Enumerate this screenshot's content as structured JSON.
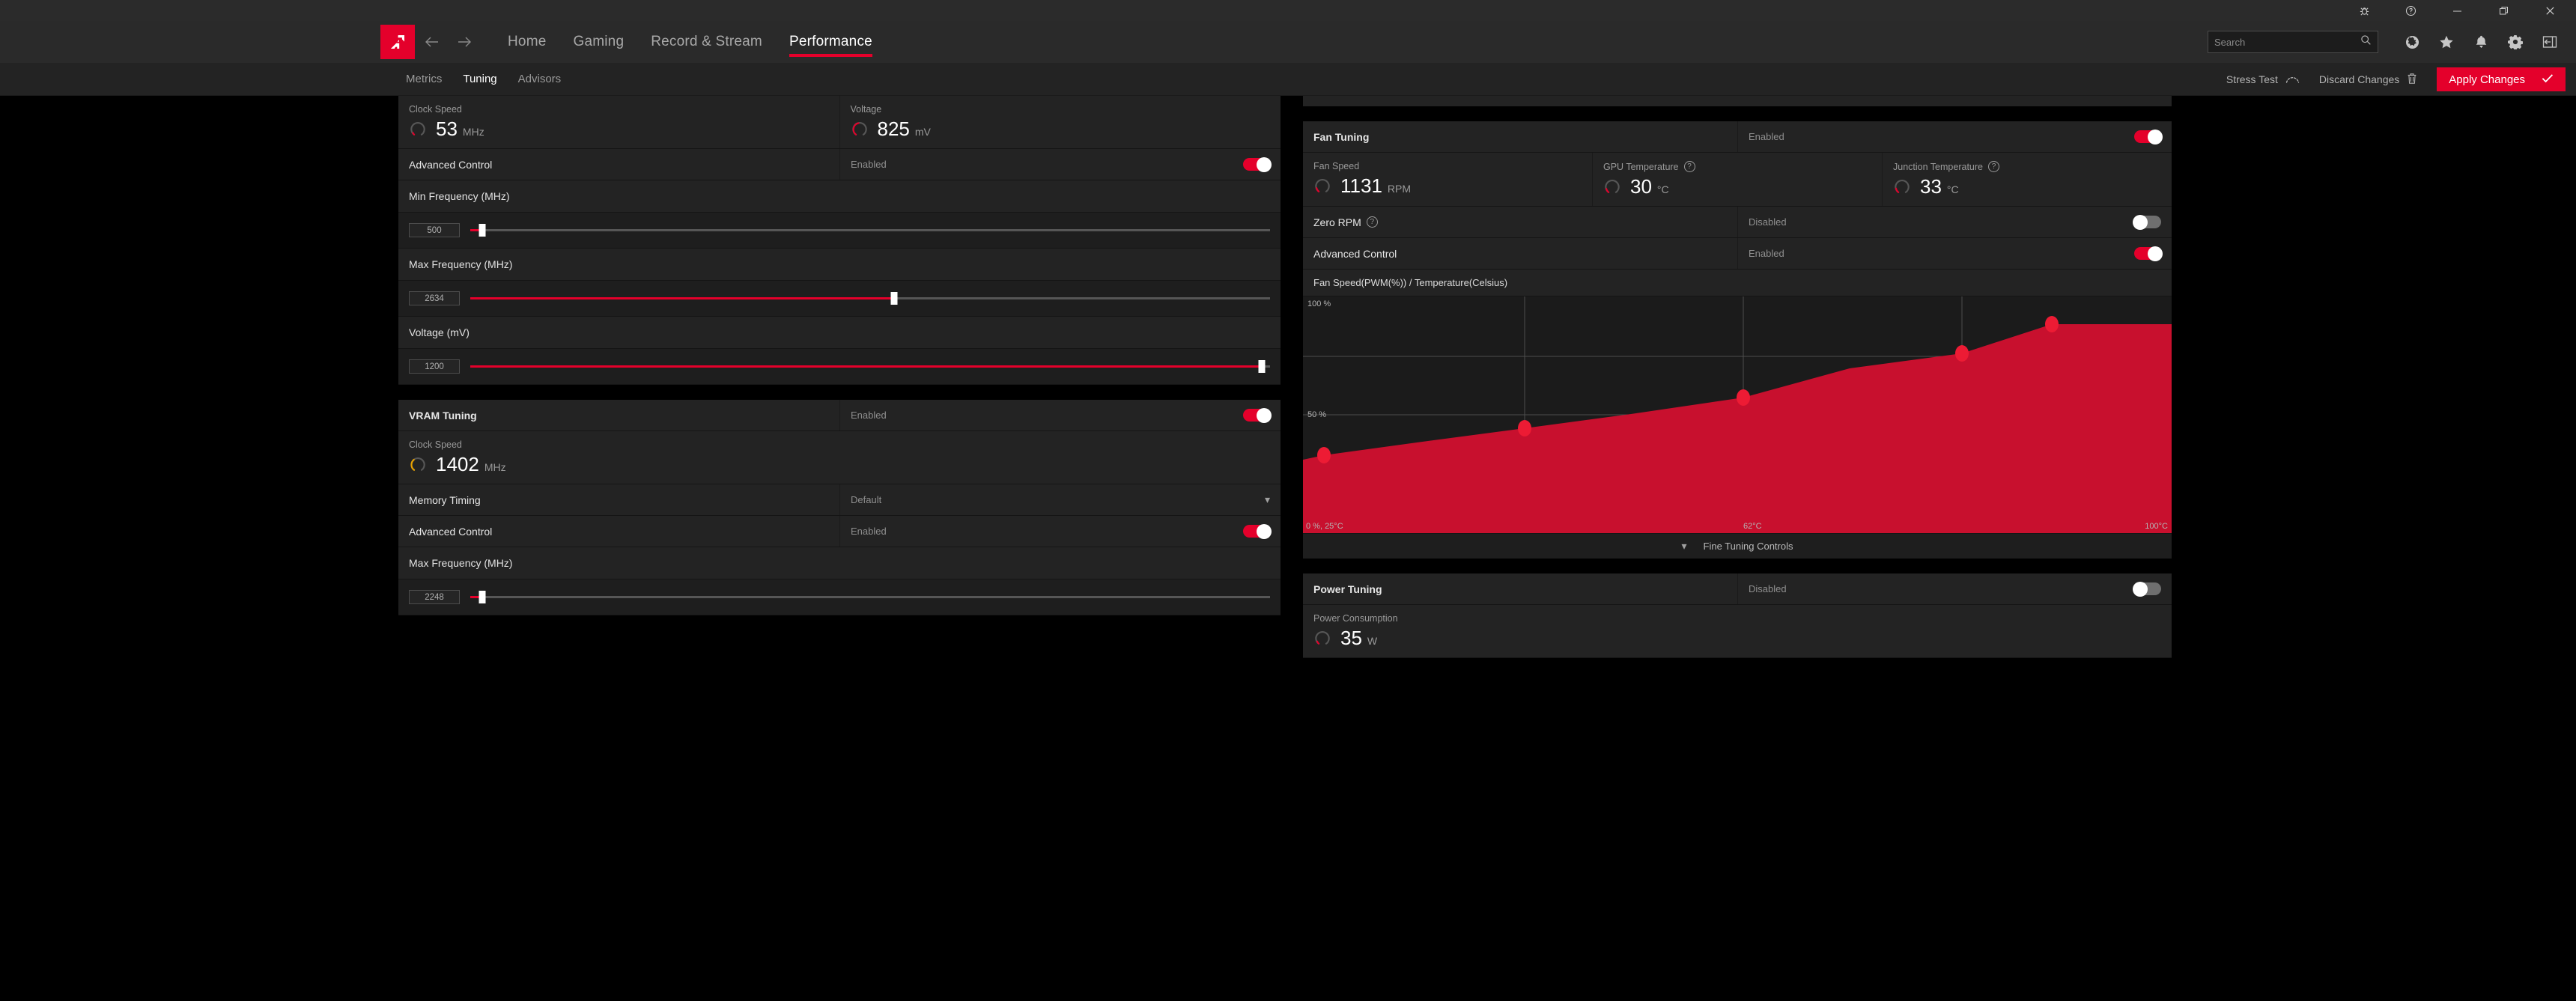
{
  "window": {
    "controls": [
      {
        "name": "bug-report",
        "glyph": "bug"
      },
      {
        "name": "help",
        "glyph": "question"
      },
      {
        "name": "minimize",
        "glyph": "minimize"
      },
      {
        "name": "restore",
        "glyph": "restore"
      },
      {
        "name": "close",
        "glyph": "close"
      }
    ]
  },
  "nav": {
    "brand": "AMD",
    "back": "back-arrow",
    "forward": "forward-arrow",
    "links": [
      {
        "label": "Home",
        "active": false
      },
      {
        "label": "Gaming",
        "active": false
      },
      {
        "label": "Record & Stream",
        "active": false
      },
      {
        "label": "Performance",
        "active": true
      }
    ],
    "search": {
      "value": "",
      "placeholder": "Search"
    },
    "icons": [
      "globe-icon",
      "star-icon",
      "bell-icon",
      "gear-icon",
      "collapse-panel-icon"
    ]
  },
  "subnav": {
    "tabs": [
      {
        "label": "Metrics",
        "active": false
      },
      {
        "label": "Tuning",
        "active": true
      },
      {
        "label": "Advisors",
        "active": false
      }
    ],
    "stress_test": "Stress Test",
    "discard": "Discard Changes",
    "apply": "Apply Changes"
  },
  "gpu_tuning": {
    "metrics": [
      {
        "label": "Clock Speed",
        "value": "53",
        "unit": "MHz",
        "gauge_pct": 4,
        "gauge_color": "#e4002b"
      },
      {
        "label": "Voltage",
        "value": "825",
        "unit": "mV",
        "gauge_pct": 45,
        "gauge_color": "#e4002b"
      }
    ],
    "advanced_control": {
      "label": "Advanced Control",
      "state": "Enabled",
      "on": true
    },
    "sliders": [
      {
        "label": "Min Frequency (MHz)",
        "value": "500",
        "pct": 1.5
      },
      {
        "label": "Max Frequency (MHz)",
        "value": "2634",
        "pct": 53
      },
      {
        "label": "Voltage (mV)",
        "value": "1200",
        "pct": 99
      }
    ]
  },
  "vram_tuning": {
    "title": "VRAM Tuning",
    "state": "Enabled",
    "on": true,
    "metric": {
      "label": "Clock Speed",
      "value": "1402",
      "unit": "MHz",
      "gauge_pct": 40,
      "gauge_color": "#e8a200"
    },
    "memory_timing": {
      "label": "Memory Timing",
      "value": "Default"
    },
    "advanced_control": {
      "label": "Advanced Control",
      "state": "Enabled",
      "on": true
    },
    "slider": {
      "label": "Max Frequency (MHz)",
      "value": "2248",
      "pct": 1.5
    }
  },
  "fan_tuning": {
    "title": "Fan Tuning",
    "state": "Enabled",
    "on": true,
    "metrics": [
      {
        "label": "Fan Speed",
        "value": "1131",
        "unit": "RPM",
        "gauge_pct": 10,
        "gauge_color": "#e4002b",
        "help": false
      },
      {
        "label": "GPU Temperature",
        "value": "30",
        "unit": "°C",
        "gauge_pct": 10,
        "gauge_color": "#e4002b",
        "help": true
      },
      {
        "label": "Junction Temperature",
        "value": "33",
        "unit": "°C",
        "gauge_pct": 11,
        "gauge_color": "#e4002b",
        "help": true
      }
    ],
    "zero_rpm": {
      "label": "Zero RPM",
      "state": "Disabled",
      "on": false,
      "help": true
    },
    "advanced_control": {
      "label": "Advanced Control",
      "state": "Enabled",
      "on": true
    },
    "fine_tuning_controls": "Fine Tuning Controls"
  },
  "power_tuning": {
    "title": "Power Tuning",
    "state": "Disabled",
    "on": false,
    "metric": {
      "label": "Power Consumption",
      "value": "35",
      "unit": "W",
      "gauge_pct": 5,
      "gauge_color": "#e4002b"
    }
  },
  "chart_data": {
    "type": "area",
    "title": "Fan Speed(PWM(%)) / Temperature(Celsius)",
    "xlabel": "Temperature(Celsius)",
    "ylabel": "Fan Speed(PWM(%))",
    "xlim": [
      25,
      100
    ],
    "ylim": [
      0,
      100
    ],
    "x": [
      25,
      30,
      50,
      62,
      80,
      90,
      100
    ],
    "y": [
      30,
      32,
      43,
      53,
      74,
      88,
      88
    ],
    "points": [
      {
        "x": 30,
        "y": 32
      },
      {
        "x": 50,
        "y": 43
      },
      {
        "x": 62,
        "y": 53
      },
      {
        "x": 80,
        "y": 74
      },
      {
        "x": 90,
        "y": 88
      }
    ],
    "ytick_labels": [
      "100 %",
      "50 %"
    ],
    "ytick_values": [
      100,
      50
    ],
    "xtick_labels": [
      "0 %, 25°C",
      "62°C",
      "100°C"
    ],
    "xtick_values": [
      25,
      62,
      100
    ],
    "grid": true,
    "legend": false,
    "area_color": "#c8102e",
    "point_color": "#ed1b34"
  }
}
